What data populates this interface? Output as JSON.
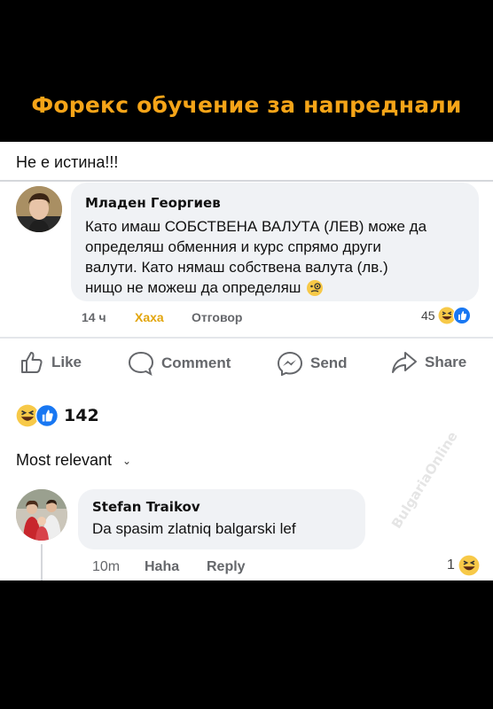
{
  "meme": {
    "title": "Форекс обучение за напреднали"
  },
  "post": {
    "text": "Не е истина!!!"
  },
  "comment1": {
    "author": "Младен Георгиев",
    "lines": [
      "Като имаш СОБСТВЕНА ВАЛУТА (ЛЕВ) може да",
      "определяш обменния и курс спрямо други",
      "валути. Като нямаш собствена валута (лв.)",
      "нищо не можеш да определяш"
    ],
    "time": "14 ч",
    "haha_label": "Хаха",
    "reply_label": "Отговор",
    "reaction_count": "45"
  },
  "actions": {
    "like": "Like",
    "comment": "Comment",
    "send": "Send",
    "share": "Share"
  },
  "post_reactions": {
    "count": "142"
  },
  "sort": {
    "label": "Most relevant"
  },
  "comment2": {
    "author": "Stefan Traikov",
    "text": "Da spasim zlatniq balgarski lef",
    "time": "10m",
    "haha_label": "Haha",
    "reply_label": "Reply",
    "reaction_count": "1"
  },
  "watermark": "BulgariaOnline",
  "colors": {
    "accent": "#f5a418",
    "haha": "#e2a50c",
    "like_blue": "#1877f2",
    "emoji_yellow": "#f7c948"
  }
}
